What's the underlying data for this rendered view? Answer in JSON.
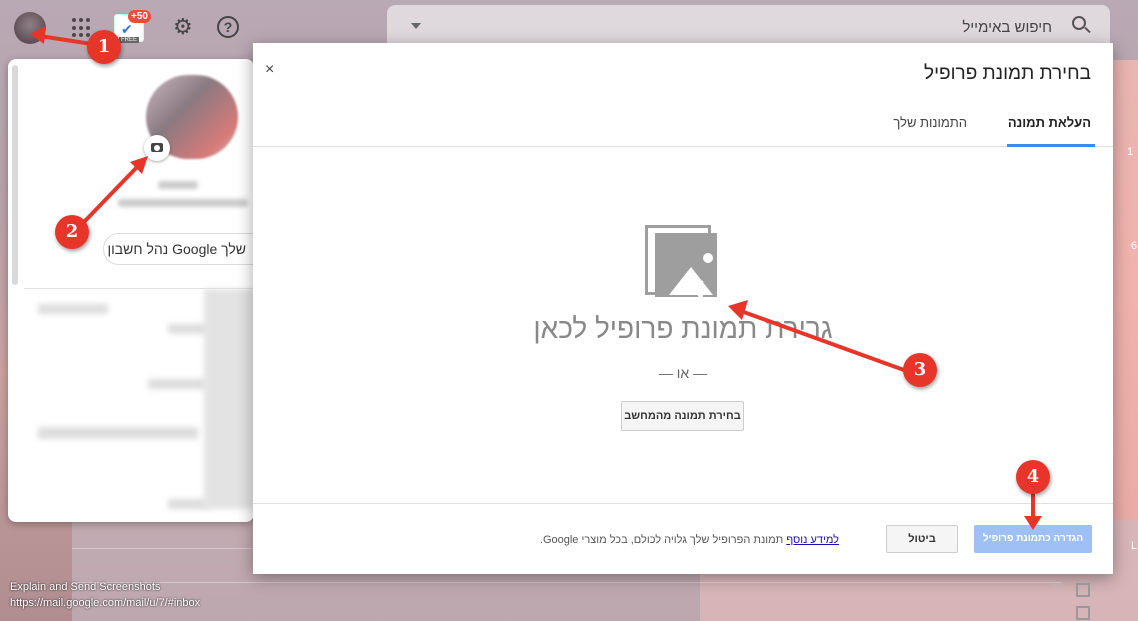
{
  "search": {
    "placeholder": "חיפוש באימייל"
  },
  "extension": {
    "badge": "+50",
    "free_label": "FREE"
  },
  "account_panel": {
    "manage_button": "שלך Google נהל חשבון"
  },
  "dialog": {
    "title": "בחירת תמונת פרופיל",
    "close": "×",
    "tabs": [
      {
        "label": "העלאת תמונה",
        "active": true
      },
      {
        "label": "התמונות שלך",
        "active": false
      }
    ],
    "drop_text": "גרירת תמונת פרופיל לכאן",
    "or_text": "— או —",
    "select_button": "בחירת תמונה מהמחשב",
    "footer_text": "תמונת הפרופיל שלך גלויה לכולם, בכל מוצרי Google.",
    "footer_link": "למידע נוסף",
    "cancel_button": "ביטול",
    "set_button": "הגדרה כתמונת פרופיל"
  },
  "annotations": {
    "markers": [
      "1",
      "2",
      "3",
      "4"
    ],
    "color": "#e8352a"
  },
  "overlay": {
    "title": "Explain and Send Screenshots",
    "url": "https://mail.google.com/mail/u/7/#inbox"
  },
  "right_edge": {
    "labels": [
      "1",
      "6",
      "L"
    ]
  }
}
